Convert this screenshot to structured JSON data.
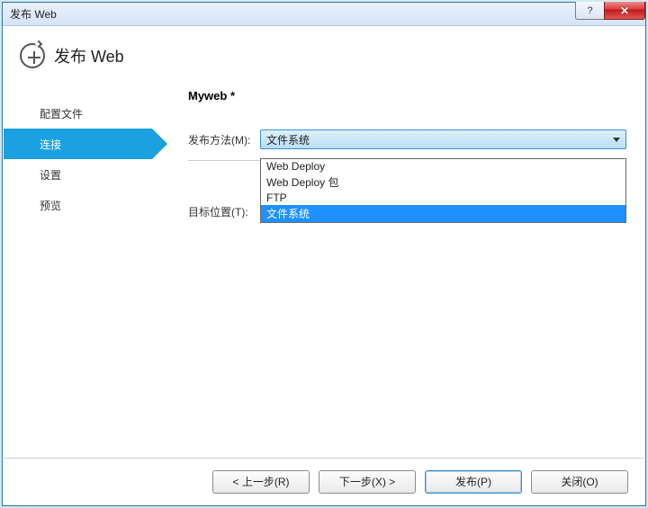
{
  "window": {
    "title": "发布 Web"
  },
  "header": {
    "title": "发布 Web"
  },
  "sidebar": {
    "items": [
      {
        "label": "配置文件"
      },
      {
        "label": "连接"
      },
      {
        "label": "设置"
      },
      {
        "label": "预览"
      }
    ],
    "active_index": 1
  },
  "main": {
    "profile_name": "Myweb *",
    "publish_method_label": "发布方法(M):",
    "target_location_label": "目标位置(T):",
    "publish_method_selected": "文件系统",
    "publish_method_options": [
      "Web Deploy",
      "Web Deploy 包",
      "FTP",
      "文件系统"
    ],
    "publish_method_highlight_index": 3,
    "browse_label": "..."
  },
  "footer": {
    "prev": "< 上一步(R)",
    "next": "下一步(X) >",
    "publish": "发布(P)",
    "close": "关闭(O)"
  }
}
